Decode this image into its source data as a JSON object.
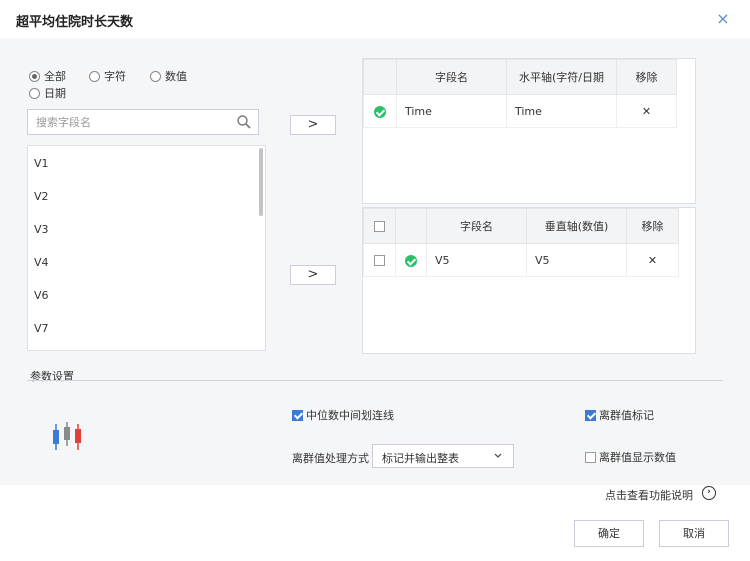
{
  "dialog": {
    "title": "超平均住院时长天数",
    "close_glyph": "×"
  },
  "filters": {
    "options": [
      {
        "label": "全部",
        "selected": true
      },
      {
        "label": "字符",
        "selected": false
      },
      {
        "label": "数值",
        "selected": false
      },
      {
        "label": "日期",
        "selected": false
      }
    ]
  },
  "search": {
    "placeholder": "搜索字段名",
    "value": ""
  },
  "fields": [
    "V1",
    "V2",
    "V3",
    "V4",
    "V6",
    "V7"
  ],
  "move_arrow": ">",
  "horizontal_table": {
    "headers": [
      "字段名",
      "水平轴(字符/日期",
      "移除"
    ],
    "rows": [
      {
        "field": "Time",
        "axis": "Time",
        "remove": "✕"
      }
    ]
  },
  "vertical_table": {
    "headers": [
      "字段名",
      "垂直轴(数值)",
      "移除"
    ],
    "rows": [
      {
        "field": "V5",
        "axis": "V5",
        "remove": "✕",
        "checked": false
      }
    ]
  },
  "params": {
    "section_label": "参数设置",
    "median_line": {
      "label": "中位数中间划连线",
      "checked": true
    },
    "outlier_mark": {
      "label": "离群值标记",
      "checked": true
    },
    "outlier_method_label": "离群值处理方式",
    "outlier_method_value": "标记并输出整表",
    "outlier_show_value": {
      "label": "离群值显示数值",
      "checked": false
    }
  },
  "help": {
    "label": "点击查看功能说明",
    "glyph": "›"
  },
  "buttons": {
    "ok": "确定",
    "cancel": "取消"
  },
  "colors": {
    "accent": "#3a7bd5",
    "success": "#2bbf6a",
    "close": "#5b8ec9"
  }
}
